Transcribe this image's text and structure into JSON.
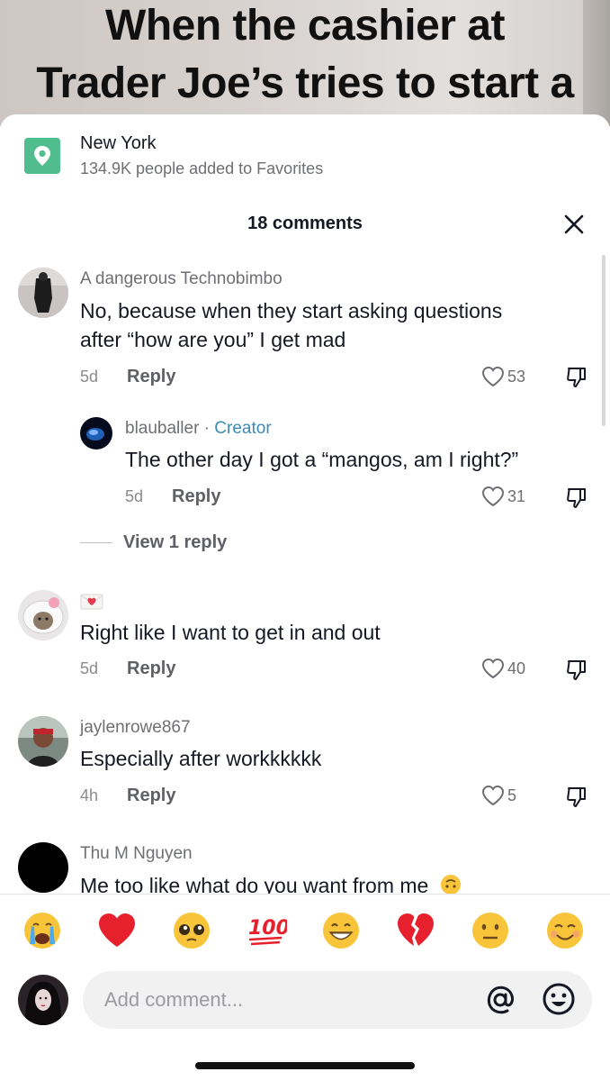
{
  "video": {
    "caption_line1": "When the cashier at",
    "caption_line2": "Trader Joe’s tries to start a"
  },
  "location": {
    "title": "New York",
    "subtitle": "134.9K people added to Favorites",
    "icon": "location-pin-icon",
    "accent": "#4fbd8d"
  },
  "comments_header": {
    "count_label": "18 comments"
  },
  "comments": [
    {
      "user": "A dangerous Technobimbo",
      "text_line1": "No, because when they start asking questions",
      "text_line2": "after “how are you” I get mad",
      "time": "5d",
      "reply_label": "Reply",
      "likes": "53"
    },
    {
      "user": "blauballer",
      "creator_separator": " · ",
      "creator_label": "Creator",
      "text": "The other day I got a “mangos, am I right?”",
      "time": "5d",
      "reply_label": "Reply",
      "likes": "31"
    },
    {
      "user": "",
      "user_icon": "heart-envelope-icon",
      "text": "Right like I want to get in and out",
      "time": "5d",
      "reply_label": "Reply",
      "likes": "40"
    },
    {
      "user": "jaylenrowe867",
      "text": "Especially after workkkkkk",
      "time": "4h",
      "reply_label": "Reply",
      "likes": "5"
    },
    {
      "user": "Thu M Nguyen",
      "text": "Me too like what do you want from me",
      "emoji": "upside-down-face-icon"
    }
  ],
  "view_replies_label": "View 1 reply",
  "emoji_bar": [
    "crying-face-icon",
    "red-heart-icon",
    "pleading-face-icon",
    "hundred-points-icon",
    "grinning-face-icon",
    "broken-heart-icon",
    "neutral-face-icon",
    "smiling-face-icon"
  ],
  "input": {
    "placeholder": "Add comment..."
  }
}
